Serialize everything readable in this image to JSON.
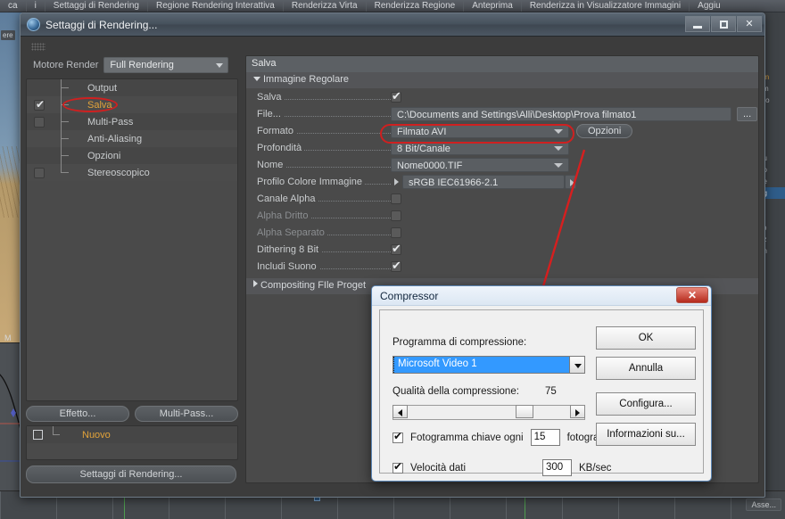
{
  "topbar": {
    "items": [
      "ca",
      "i",
      "Settaggi di Rendering",
      "Regione Rendering Interattiva",
      "Renderizza Virta",
      "Renderizza Regione",
      "Anteprima",
      "Renderizza in Visualizzatore Immagini",
      "Aggiu"
    ]
  },
  "viewport": {
    "label": "ere",
    "curve_label": "M"
  },
  "right_panel": {
    "lines": [
      "el",
      "ivi",
      "am",
      "sm",
      "ero",
      "/p",
      "/p",
      "/p",
      "/p",
      "bu",
      "do",
      "ne",
      "ag",
      "a",
      "or",
      "so",
      "nz",
      "on",
      "nt"
    ],
    "highlight_index": 2,
    "selected_index": 12
  },
  "timeline": {
    "asse_label": "Asse..."
  },
  "window": {
    "title": "Settaggi di Rendering...",
    "minimize": "minimize-glyph",
    "maximize": "maximize-glyph",
    "close": "✕"
  },
  "left_pane": {
    "engine_label": "Motore Render",
    "engine_value": "Full Rendering",
    "tree": [
      {
        "label": "Output",
        "checkbox": "hidden",
        "active": false
      },
      {
        "label": "Salva",
        "checkbox": "checked",
        "active": true
      },
      {
        "label": "Multi-Pass",
        "checkbox": "unchecked",
        "active": false
      },
      {
        "label": "Anti-Aliasing",
        "checkbox": "hidden",
        "active": false
      },
      {
        "label": "Opzioni",
        "checkbox": "hidden",
        "active": false
      },
      {
        "label": "Stereoscopico",
        "checkbox": "unchecked",
        "active": false
      }
    ],
    "effetto_button": "Effetto...",
    "multipass_button": "Multi-Pass...",
    "nuovo_label": "Nuovo",
    "footer_button": "Settaggi di Rendering..."
  },
  "right_pane": {
    "pane_title": "Salva",
    "group_title": "Immagine Regolare",
    "rows": [
      {
        "label": "Salva",
        "type": "checkbox",
        "value": "checked"
      },
      {
        "label": "File...",
        "type": "path",
        "value": "C:\\Documents and Settings\\Alli\\Desktop\\Prova filmato1",
        "browse": "..."
      },
      {
        "label": "Formato",
        "type": "dropdown",
        "value": "Filmato AVI",
        "extra_button": "Opzioni"
      },
      {
        "label": "Profondità",
        "type": "dropdown",
        "value": "8 Bit/Canale"
      },
      {
        "label": "Nome",
        "type": "dropdown",
        "value": "Nome0000.TIF"
      },
      {
        "label": "Profilo Colore Immagine",
        "type": "picker",
        "value": "sRGB IEC61966-2.1"
      },
      {
        "label": "Canale Alpha",
        "type": "checkbox",
        "value": "unchecked"
      },
      {
        "label": "Alpha Dritto",
        "type": "checkbox",
        "value": "unchecked",
        "dim": true
      },
      {
        "label": "Alpha Separato",
        "type": "checkbox",
        "value": "unchecked",
        "dim": true
      },
      {
        "label": "Dithering 8 Bit",
        "type": "checkbox",
        "value": "checked"
      },
      {
        "label": "Includi Suono",
        "type": "checkbox",
        "value": "checked"
      }
    ],
    "compositing_group": "Compositing FIle Proget"
  },
  "compressor": {
    "title": "Compressor",
    "close": "✕",
    "program_label": "Programma di compressione:",
    "program_value": "Microsoft Video 1",
    "quality_label": "Qualità della compressione:",
    "quality_value": "75",
    "keyframe_label": "Fotogramma chiave ogni",
    "keyframe_value": "15",
    "keyframe_unit": "fotogrammi",
    "keyframe_checked": "checked",
    "datarate_label": "Velocità dati",
    "datarate_value": "300",
    "datarate_unit": "KB/sec",
    "datarate_checked": "checked",
    "buttons": [
      "OK",
      "Annulla",
      "Configura...",
      "Informazioni su..."
    ]
  },
  "colors": {
    "accent_orange": "#e2a33a",
    "annotation_red": "#cf2020",
    "selection_blue": "#3399ff",
    "window_bg": "#3c3c3c"
  }
}
